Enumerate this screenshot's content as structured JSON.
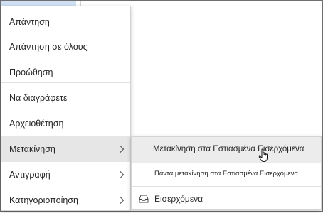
{
  "context_menu": {
    "items": [
      {
        "label": "Απάντηση",
        "has_submenu": false
      },
      {
        "label": "Απάντηση σε όλους",
        "has_submenu": false
      },
      {
        "label": "Προώθηση",
        "has_submenu": false
      },
      {
        "label": "Να διαγράφετε",
        "has_submenu": false
      },
      {
        "label": "Αρχειοθέτηση",
        "has_submenu": false
      },
      {
        "label": "Μετακίνηση",
        "has_submenu": true,
        "active": true
      },
      {
        "label": "Αντιγραφή",
        "has_submenu": true
      },
      {
        "label": "Κατηγοριοποίηση",
        "has_submenu": true
      }
    ]
  },
  "submenu": {
    "items": [
      {
        "label": "Μετακίνηση στα Εστιασμένα Εισερχόμενα",
        "hovered": true
      },
      {
        "label": "Πάντα μετακίνηση στα Εστιασμένα Εισερχόμενα"
      },
      {
        "label": "Εισερχόμενα",
        "icon": "inbox-icon"
      }
    ]
  },
  "colors": {
    "active_item_bg": "#e6e6e6",
    "hover_item_bg": "#ececec",
    "selected_strip": "#cfe1f3",
    "text": "#262626"
  }
}
